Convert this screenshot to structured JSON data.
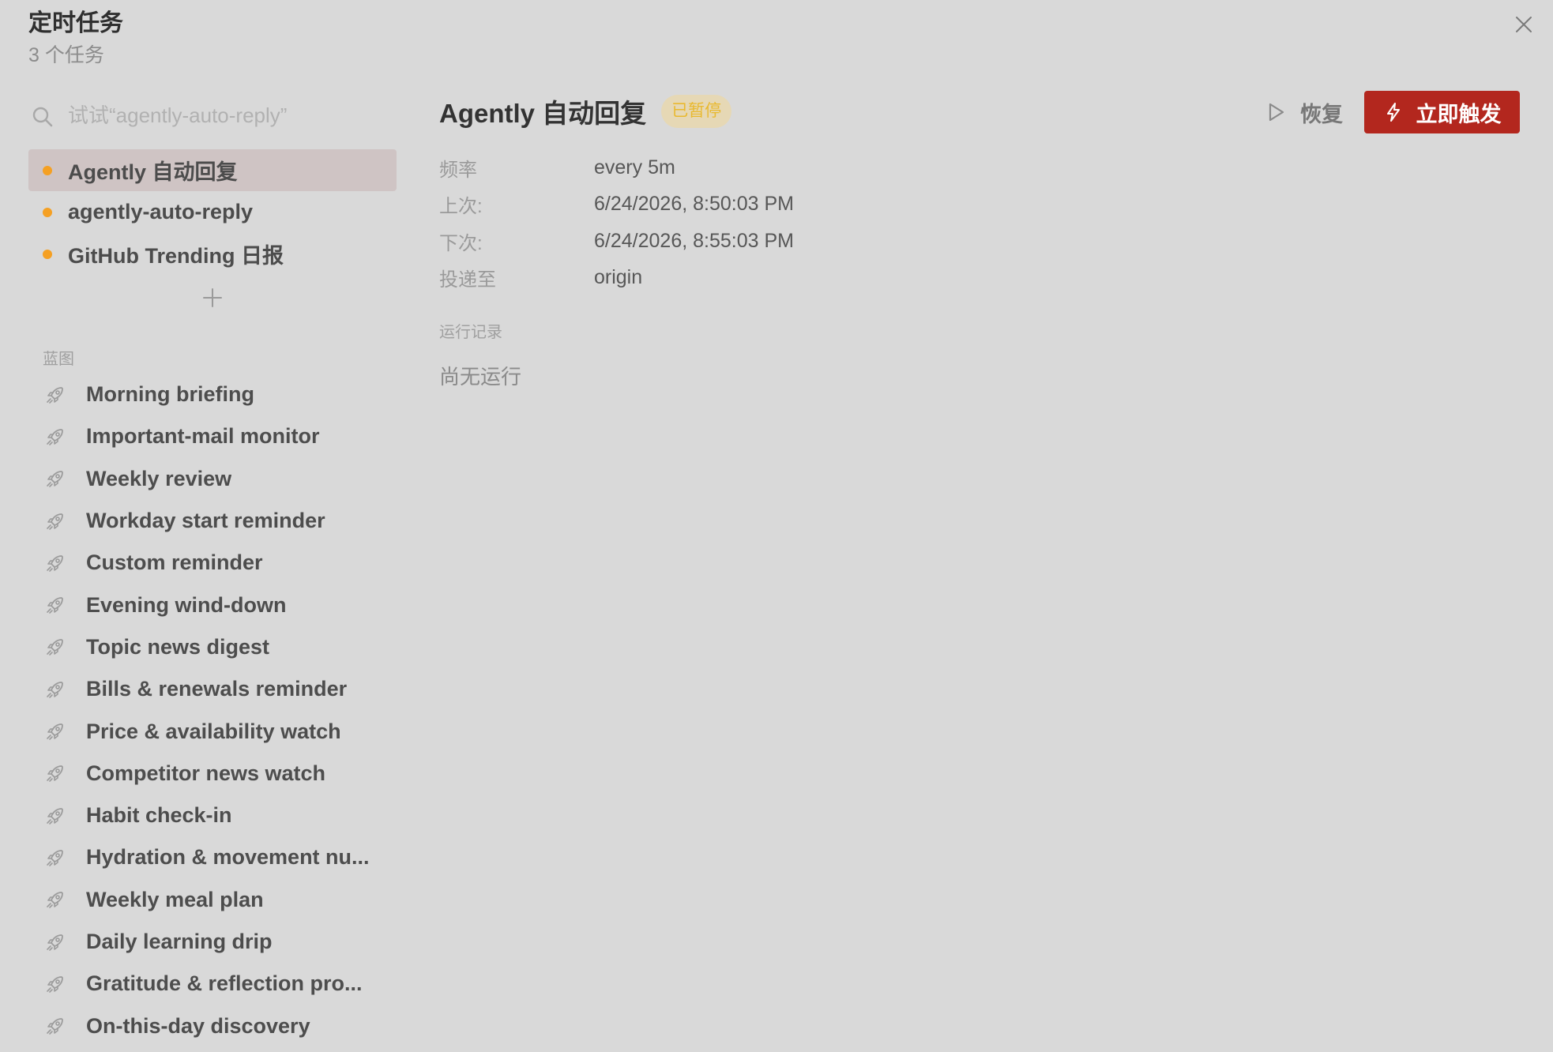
{
  "header": {
    "title": "定时任务",
    "subtitle": "3 个任务"
  },
  "search": {
    "placeholder": "试试“agently-auto-reply”"
  },
  "tasks": [
    {
      "label": "Agently 自动回复",
      "selected": true,
      "dot_color": "#f5a023"
    },
    {
      "label": "agently-auto-reply",
      "selected": false,
      "dot_color": "#f5a023"
    },
    {
      "label": "GitHub Trending 日报",
      "selected": false,
      "dot_color": "#f5a023"
    }
  ],
  "blueprints": {
    "heading": "蓝图",
    "items": [
      {
        "label": "Morning briefing"
      },
      {
        "label": "Important-mail monitor"
      },
      {
        "label": "Weekly review"
      },
      {
        "label": "Workday start reminder"
      },
      {
        "label": "Custom reminder"
      },
      {
        "label": "Evening wind-down"
      },
      {
        "label": "Topic news digest"
      },
      {
        "label": "Bills & renewals reminder"
      },
      {
        "label": "Price & availability watch"
      },
      {
        "label": "Competitor news watch"
      },
      {
        "label": "Habit check-in"
      },
      {
        "label": "Hydration & movement nu..."
      },
      {
        "label": "Weekly meal plan"
      },
      {
        "label": "Daily learning drip"
      },
      {
        "label": "Gratitude & reflection pro..."
      },
      {
        "label": "On-this-day discovery"
      }
    ]
  },
  "detail": {
    "title": "Agently 自动回复",
    "status": "已暂停",
    "resume_label": "恢复",
    "trigger_label": "立即触发",
    "fields": [
      {
        "label": "频率",
        "value": "every 5m"
      },
      {
        "label": "上次:",
        "value": "6/24/2026, 8:50:03 PM"
      },
      {
        "label": "下次:",
        "value": "6/24/2026, 8:55:03 PM"
      },
      {
        "label": "投递至",
        "value": "origin"
      }
    ],
    "runs_heading": "运行记录",
    "runs_empty": "尚无运行"
  },
  "icons": {
    "close": "close-icon",
    "search": "search-icon",
    "add": "plus-icon",
    "blueprint": "rocket-icon",
    "resume": "play-icon",
    "trigger": "lightning-icon"
  },
  "colors": {
    "background": "#d9d9d9",
    "accent": "#b3271e",
    "selected_row": "#cfc4c4",
    "status_dot": "#f5a023",
    "badge_bg": "#e6d8b5",
    "badge_text": "#e9b92f"
  }
}
